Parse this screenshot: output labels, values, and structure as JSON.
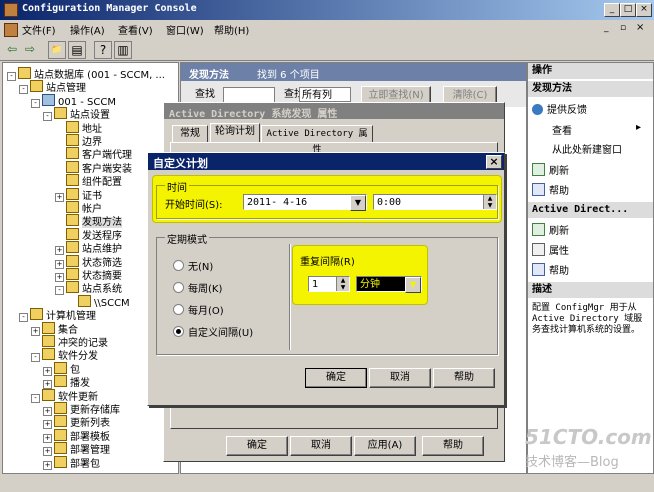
{
  "window": {
    "title": "Configuration Manager Console",
    "min": "_",
    "max": "□",
    "close": "×"
  },
  "menu": [
    "文件(F)",
    "操作(A)",
    "查看(V)",
    "窗口(W)",
    "帮助(H)"
  ],
  "tree": {
    "rows": [
      {
        "label": "站点数据库  (001 - SCCM, ...",
        "indent": 0,
        "exp": "-"
      },
      {
        "label": "站点管理",
        "indent": 1,
        "exp": "-"
      },
      {
        "label": "001 - SCCM",
        "indent": 2,
        "exp": "-"
      },
      {
        "label": "站点设置",
        "indent": 3,
        "exp": "-"
      },
      {
        "label": "地址",
        "indent": 4,
        "exp": ""
      },
      {
        "label": "边界",
        "indent": 4,
        "exp": ""
      },
      {
        "label": "客户端代理",
        "indent": 4,
        "exp": ""
      },
      {
        "label": "客户端安装",
        "indent": 4,
        "exp": ""
      },
      {
        "label": "组件配置",
        "indent": 4,
        "exp": ""
      },
      {
        "label": "证书",
        "indent": 4,
        "exp": "+"
      },
      {
        "label": "帐户",
        "indent": 4,
        "exp": ""
      },
      {
        "label": "发现方法",
        "indent": 4,
        "exp": "",
        "selected": true
      },
      {
        "label": "发送程序",
        "indent": 4,
        "exp": ""
      },
      {
        "label": "站点维护",
        "indent": 4,
        "exp": "+"
      },
      {
        "label": "状态筛选",
        "indent": 4,
        "exp": "+"
      },
      {
        "label": "状态摘要",
        "indent": 4,
        "exp": "+"
      },
      {
        "label": "站点系统",
        "indent": 4,
        "exp": "-"
      },
      {
        "label": "\\\\SCCM",
        "indent": 5,
        "exp": ""
      },
      {
        "label": "计算机管理",
        "indent": 1,
        "exp": "-"
      },
      {
        "label": "集合",
        "indent": 2,
        "exp": "+"
      },
      {
        "label": "冲突的记录",
        "indent": 2,
        "exp": ""
      },
      {
        "label": "软件分发",
        "indent": 2,
        "exp": "-"
      },
      {
        "label": "包",
        "indent": 3,
        "exp": "+"
      },
      {
        "label": "播发",
        "indent": 3,
        "exp": "+"
      },
      {
        "label": "软件更新",
        "indent": 2,
        "exp": "-"
      },
      {
        "label": "更新存储库",
        "indent": 3,
        "exp": "+"
      },
      {
        "label": "更新列表",
        "indent": 3,
        "exp": "+"
      },
      {
        "label": "部署模板",
        "indent": 3,
        "exp": "+"
      },
      {
        "label": "部署管理",
        "indent": 3,
        "exp": "+"
      },
      {
        "label": "部署包",
        "indent": 3,
        "exp": "+"
      }
    ]
  },
  "middle": {
    "header_title": "发现方法",
    "header_count": "找到 6 个项目",
    "find_label": "查找",
    "find_in_label": "查找",
    "find_in_value": "所有列",
    "find_now": "立即查找(N)",
    "clear": "清除(C)"
  },
  "properties": {
    "title": "Active Directory 系统发现 属性",
    "tabs": [
      "常规",
      "轮询计划",
      "Active Directory 属性"
    ],
    "ok": "确定",
    "cancel": "取消",
    "apply": "应用(A)",
    "help": "帮助"
  },
  "schedule": {
    "title": "自定义计划",
    "time_group": "时间",
    "start_time_label": "开始时间(S):",
    "start_date": "2011- 4-16",
    "start_clock": "0:00",
    "pattern_group": "定期模式",
    "radios": [
      {
        "label": "无(N)",
        "checked": false
      },
      {
        "label": "每周(K)",
        "checked": false
      },
      {
        "label": "每月(O)",
        "checked": false
      },
      {
        "label": "自定义间隔(U)",
        "checked": true
      }
    ],
    "interval_label": "重复间隔(R)",
    "interval_value": "1",
    "interval_unit": "分钟",
    "ok": "确定",
    "cancel": "取消",
    "help": "帮助"
  },
  "actions": {
    "head1": "操作",
    "head2": "发现方法",
    "items1": [
      "提供反馈",
      "查看",
      "从此处新建窗口",
      "刷新",
      "帮助"
    ],
    "head3": "Active Direct...",
    "items2": [
      "刷新",
      "属性",
      "帮助"
    ],
    "head4": "描述",
    "description": "配置 ConfigMgr 用于从 Active Directory 域服务查找计算机系统的设置。"
  },
  "watermark": {
    "line1": "51CTO.com",
    "line2": "技术博客—Blog"
  },
  "colors": {
    "highlight": "#f4f400",
    "titlebar": "#0a246a",
    "unit_field_bg": "#000000"
  }
}
